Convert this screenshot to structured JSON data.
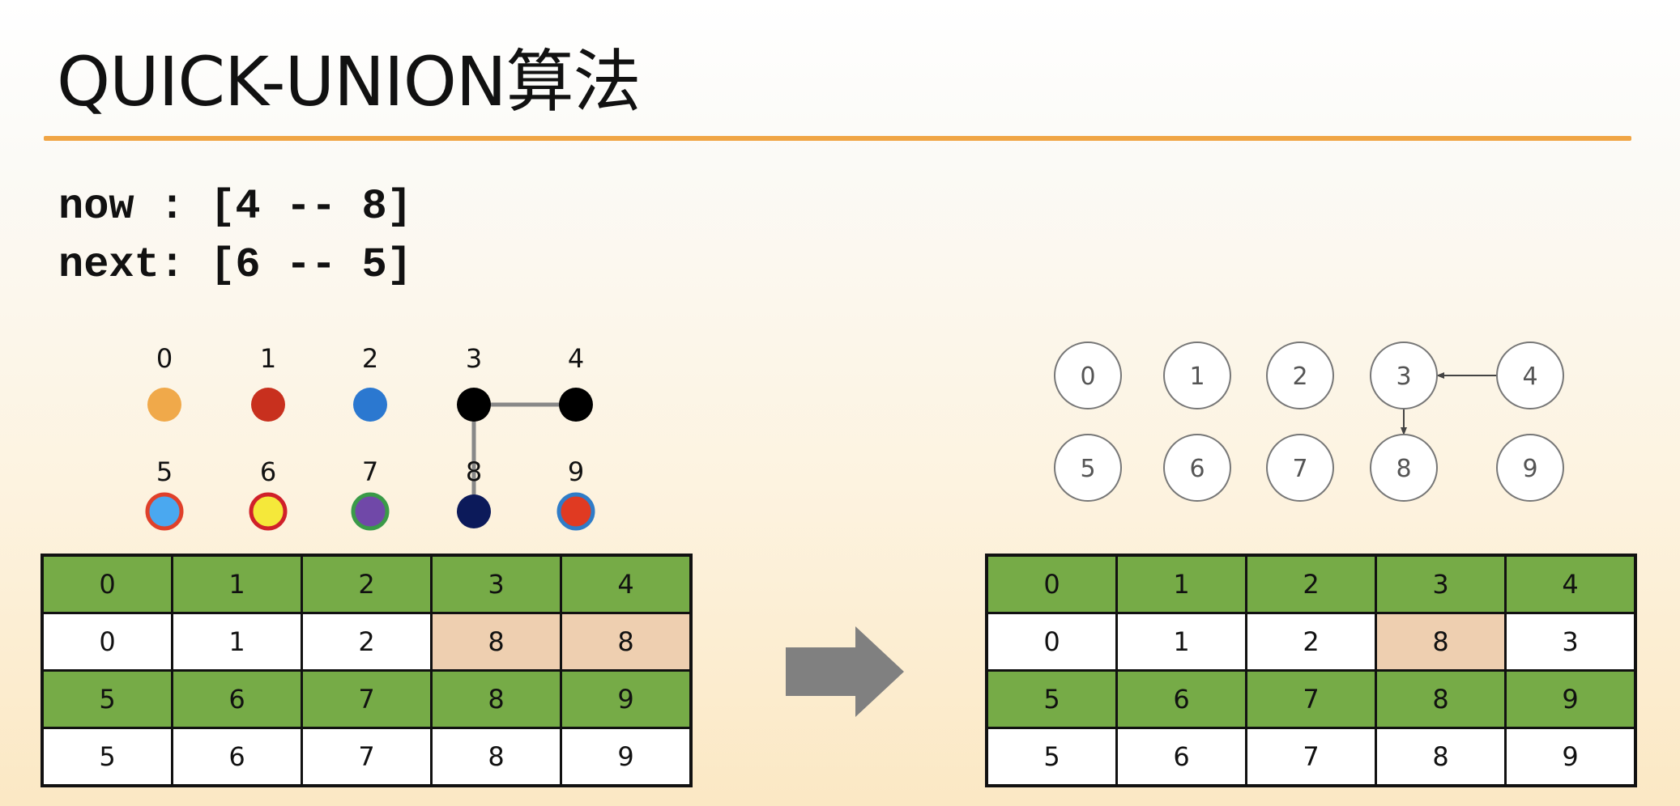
{
  "title": "QUICK-UNION算法",
  "ops": {
    "now": "now : [4 -- 8]",
    "next": "next: [6 -- 5]"
  },
  "colors": {
    "accent_rule": "#f0a545",
    "index_row_bg": "#76ab47",
    "highlight_bg": "#eecfb0",
    "arrow_gray": "#808080"
  },
  "left_graph": {
    "nodes": [
      {
        "label": "0",
        "fill": "#f0a94a"
      },
      {
        "label": "1",
        "fill": "#c8301e"
      },
      {
        "label": "2",
        "fill": "#2b78d0"
      },
      {
        "label": "3",
        "fill": "#000000"
      },
      {
        "label": "4",
        "fill": "#000000"
      },
      {
        "label": "5",
        "fill": "#4aa8f0",
        "ring": "#e0402a"
      },
      {
        "label": "6",
        "fill": "#f5e83a",
        "ring": "#d0202a"
      },
      {
        "label": "7",
        "fill": "#7048a8",
        "ring": "#3a9a48"
      },
      {
        "label": "8",
        "fill": "#0c1a5a"
      },
      {
        "label": "9",
        "fill": "#e03a22",
        "ring": "#2f7cc8"
      }
    ],
    "edges": [
      [
        "3",
        "4"
      ],
      [
        "3",
        "8"
      ]
    ]
  },
  "right_graph": {
    "nodes": [
      "0",
      "1",
      "2",
      "3",
      "4",
      "5",
      "6",
      "7",
      "8",
      "9"
    ],
    "arrows": [
      [
        "4",
        "3"
      ],
      [
        "3",
        "8"
      ]
    ]
  },
  "table_before": {
    "rows": [
      {
        "kind": "idx",
        "cells": [
          "0",
          "1",
          "2",
          "3",
          "4"
        ]
      },
      {
        "kind": "val",
        "cells": [
          "0",
          "1",
          "2",
          "8",
          "8"
        ],
        "highlight": [
          3,
          4
        ]
      },
      {
        "kind": "idx",
        "cells": [
          "5",
          "6",
          "7",
          "8",
          "9"
        ]
      },
      {
        "kind": "val",
        "cells": [
          "5",
          "6",
          "7",
          "8",
          "9"
        ]
      }
    ]
  },
  "table_after": {
    "rows": [
      {
        "kind": "idx",
        "cells": [
          "0",
          "1",
          "2",
          "3",
          "4"
        ]
      },
      {
        "kind": "val",
        "cells": [
          "0",
          "1",
          "2",
          "8",
          "3"
        ],
        "highlight": [
          3
        ]
      },
      {
        "kind": "idx",
        "cells": [
          "5",
          "6",
          "7",
          "8",
          "9"
        ]
      },
      {
        "kind": "val",
        "cells": [
          "5",
          "6",
          "7",
          "8",
          "9"
        ]
      }
    ]
  }
}
